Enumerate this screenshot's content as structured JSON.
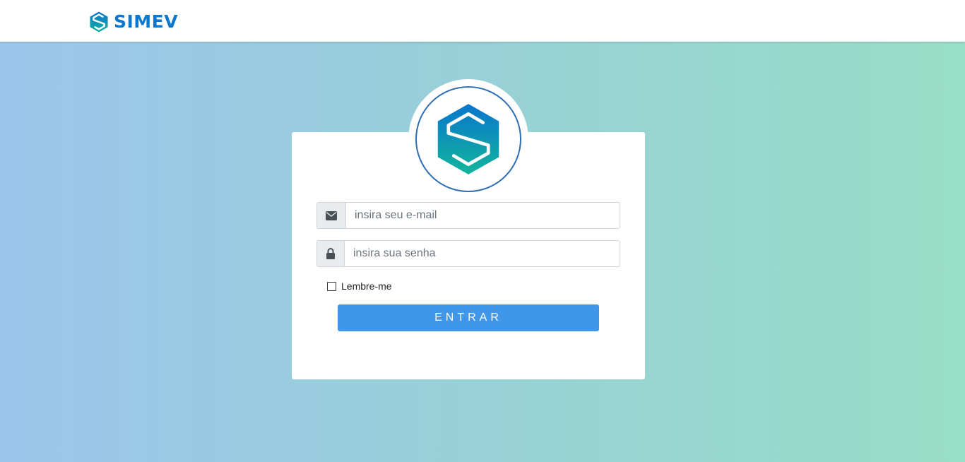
{
  "header": {
    "brand_name": "SIMEV",
    "logo_icon": "simev-hexagon-logo"
  },
  "login": {
    "logo_icon": "simev-hexagon-logo",
    "email": {
      "icon": "envelope-icon",
      "placeholder": "insira seu e-mail",
      "value": ""
    },
    "password": {
      "icon": "lock-icon",
      "placeholder": "insira sua senha",
      "value": ""
    },
    "remember": {
      "label": "Lembre-me",
      "checked": false
    },
    "submit_label": "ENTRAR"
  },
  "colors": {
    "brand": "#0b77cf",
    "button": "#4096e8",
    "logo_ring": "#2e6db6",
    "bg_left": "#9cc6ec",
    "bg_right": "#99dec6"
  }
}
